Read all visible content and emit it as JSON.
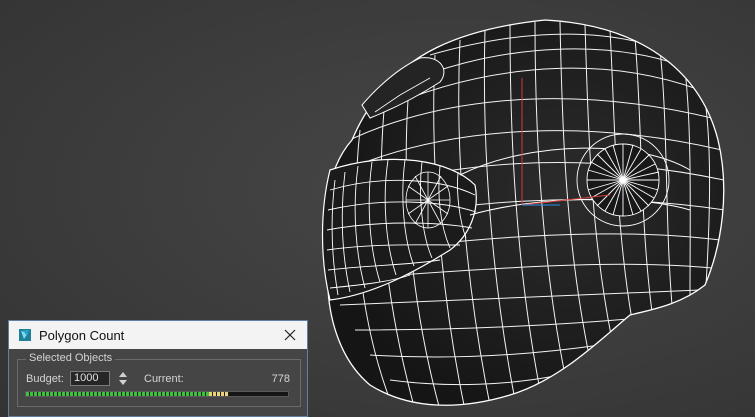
{
  "dialog": {
    "title": "Polygon Count",
    "group_label": "Selected Objects",
    "budget_label": "Budget:",
    "budget_value": "1000",
    "current_label": "Current:",
    "current_value": "778",
    "progress_fraction": 0.778,
    "progress_warn_start_fraction": 0.7
  },
  "colors": {
    "progress_ok": "#3ec13e",
    "progress_warn": "#e9d27a",
    "wire": "#ffffff",
    "axis_red": "#d23a3a",
    "app_icon": "#23a3c4"
  },
  "icons": [
    "app-logo-icon",
    "close-icon",
    "spinner-up-icon",
    "spinner-down-icon"
  ]
}
